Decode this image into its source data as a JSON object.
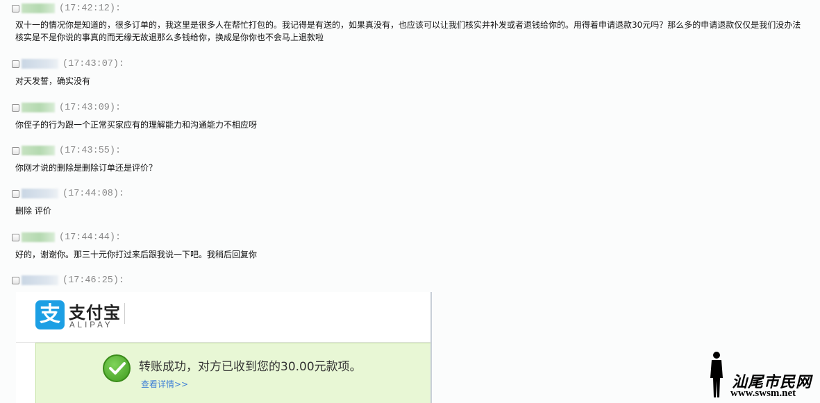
{
  "messages": [
    {
      "time": "(17:42:12):",
      "text": "双十一的情况你是知道的，很多订单的，我这里是很多人在帮忙打包的。我记得是有送的，如果真没有，也应该可以让我们核实并补发或者退钱给你的。用得着申请退款30元吗？那么多的申请退款仅仅是我们没办法核实是不是你说的事真的而无缘无故退那么多钱给你，换成是你你也不会马上退款啦"
    },
    {
      "time": "(17:43:07):",
      "text": "对天发誓，确实没有"
    },
    {
      "time": "(17:43:09):",
      "text": "你侄子的行为跟一个正常买家应有的理解能力和沟通能力不相应呀"
    },
    {
      "time": "(17:43:55):",
      "text": "你刚才说的删除是删除订单还是评价？"
    },
    {
      "time": "(17:44:08):",
      "text": "删除 评价"
    },
    {
      "time": "(17:44:44):",
      "text": "好的，谢谢你。那三十元你打过来后跟我说一下吧。我稍后回复你"
    },
    {
      "time": "(17:46:25):",
      "text": ""
    }
  ],
  "alipay": {
    "logo_glyph": "支",
    "brand_cn": "支付宝",
    "brand_en": "ALIPAY",
    "success_text": "转账成功，对方已收到您的30.00元款项。",
    "details_link": "查看详情>>",
    "brand_color": "#1c9fe4"
  },
  "watermark": {
    "site_cn": "汕尾市民网",
    "site_url": "www.swsm.net"
  }
}
